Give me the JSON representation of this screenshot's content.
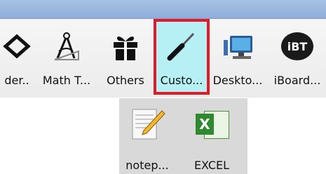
{
  "toolbar": {
    "items": [
      {
        "label": "der..",
        "icon": "border-icon"
      },
      {
        "label": "Math T...",
        "icon": "math-tools-icon"
      },
      {
        "label": "Others",
        "icon": "gift-icon"
      },
      {
        "label": "Custo...",
        "icon": "screwdriver-icon",
        "selected": true
      },
      {
        "label": "Deskto...",
        "icon": "desktop-icon"
      },
      {
        "label": "iBoard...",
        "icon": "iboard-icon",
        "icon_text": "iBT"
      }
    ]
  },
  "submenu": {
    "items": [
      {
        "label": "notep...",
        "icon": "notepad-icon"
      },
      {
        "label": "EXCEL",
        "icon": "excel-icon",
        "icon_text": "X"
      }
    ]
  },
  "colors": {
    "selected_bg": "#b6f0f5",
    "selected_border": "#e31a24",
    "title_bar": "#a9c2e6",
    "submenu_bg": "#d9d9d9"
  }
}
